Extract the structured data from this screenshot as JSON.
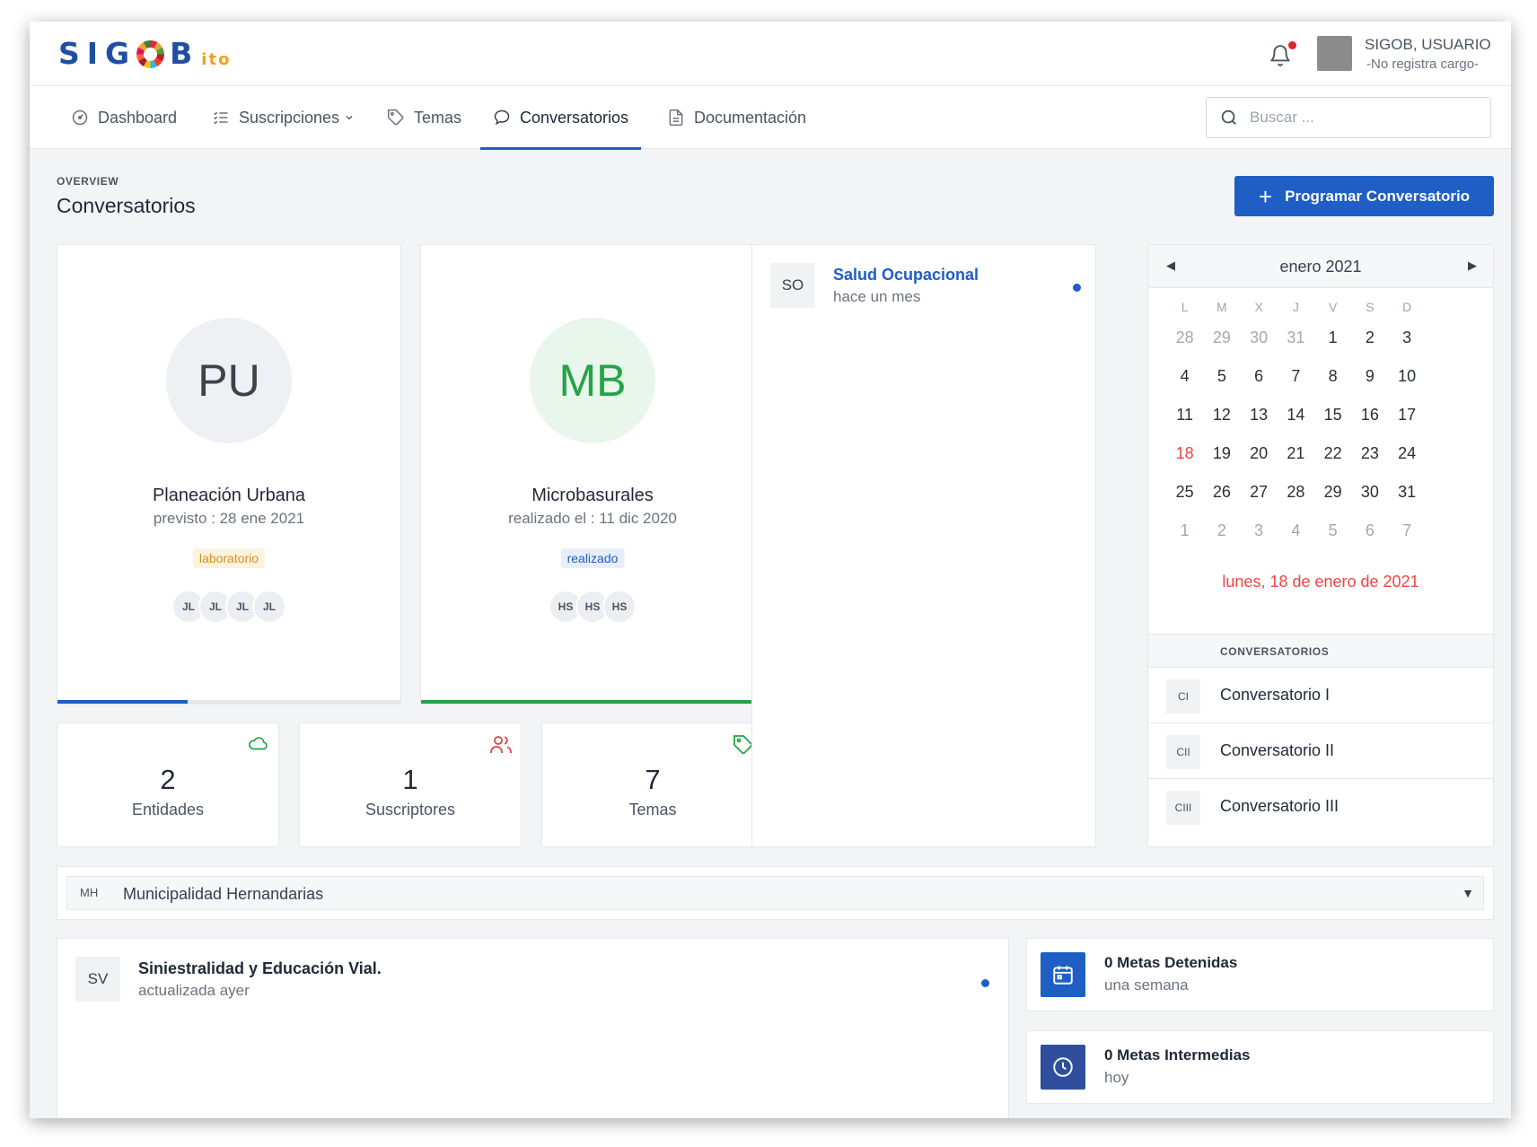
{
  "app": {
    "logo_main": "SIGOB",
    "logo_sub": "ito",
    "user_name": "SIGOB, USUARIO",
    "user_role": "-No registra cargo-",
    "notification_color": "#e02424"
  },
  "nav": {
    "tabs": [
      {
        "label": "Dashboard",
        "icon": "dashboard-icon"
      },
      {
        "label": "Suscripciones",
        "icon": "list-check-icon",
        "has_dropdown": true
      },
      {
        "label": "Temas",
        "icon": "tag-icon"
      },
      {
        "label": "Conversatorios",
        "icon": "chat-icon",
        "active": true
      },
      {
        "label": "Documentación",
        "icon": "document-icon"
      }
    ],
    "search_placeholder": "Buscar ..."
  },
  "page": {
    "eyebrow": "OVERVIEW",
    "title": "Conversatorios",
    "primary_button": "Programar Conversatorio",
    "accent_color": "#1e5ec5"
  },
  "projects": [
    {
      "initials": "PU",
      "name": "Planeación Urbana",
      "date": "previsto : 28 ene 2021",
      "badge": "laboratorio",
      "members": [
        "JL",
        "JL",
        "JL",
        "JL"
      ],
      "progress": 0.38,
      "progress_color": "#1e5ec5"
    },
    {
      "initials": "MB",
      "name": "Microbasurales",
      "date": "realizado el : 11 dic 2020",
      "badge": "realizado",
      "members": [
        "HS",
        "HS",
        "HS"
      ],
      "progress": 1.0,
      "progress_color": "#22a447"
    }
  ],
  "stats": [
    {
      "value": "2",
      "label": "Entidades",
      "icon": "cloud-icon",
      "icon_color": "#22a447"
    },
    {
      "value": "1",
      "label": "Suscriptores",
      "icon": "users-icon",
      "icon_color": "#e0443e"
    },
    {
      "value": "7",
      "label": "Temas",
      "icon": "tag-icon",
      "icon_color": "#22a447"
    }
  ],
  "feed": {
    "initials": "SO",
    "title": "Salud Ocupacional",
    "subtitle": "hace un mes"
  },
  "calendar": {
    "month": "enero 2021",
    "weekdays": [
      "L",
      "M",
      "X",
      "J",
      "V",
      "S",
      "D"
    ],
    "weeks": [
      [
        "28",
        "29",
        "30",
        "31",
        "1",
        "2",
        "3"
      ],
      [
        "4",
        "5",
        "6",
        "7",
        "8",
        "9",
        "10"
      ],
      [
        "11",
        "12",
        "13",
        "14",
        "15",
        "16",
        "17"
      ],
      [
        "18",
        "19",
        "20",
        "21",
        "22",
        "23",
        "24"
      ],
      [
        "25",
        "26",
        "27",
        "28",
        "29",
        "30",
        "31"
      ],
      [
        "1",
        "2",
        "3",
        "4",
        "5",
        "6",
        "7"
      ]
    ],
    "selected_text": "lunes, 18 de enero de 2021",
    "section_label": "CONVERSATORIOS",
    "items": [
      {
        "initials": "CI",
        "label": "Conversatorio I"
      },
      {
        "initials": "CII",
        "label": "Conversatorio II"
      },
      {
        "initials": "CIII",
        "label": "Conversatorio III"
      }
    ]
  },
  "entity_select": {
    "initials": "MH",
    "value": "Municipalidad Hernandarias"
  },
  "bottom_feed": {
    "initials": "SV",
    "title": "Siniestralidad y Educación Vial.",
    "subtitle": "actualizada ayer"
  },
  "metrics": [
    {
      "title": "0 Metas Detenidas",
      "subtitle": "una semana",
      "icon": "calendar-icon",
      "color": "#1e5ec5"
    },
    {
      "title": "0 Metas Intermedias",
      "subtitle": "hoy",
      "icon": "clock-icon",
      "color": "#2f4f9e"
    }
  ]
}
